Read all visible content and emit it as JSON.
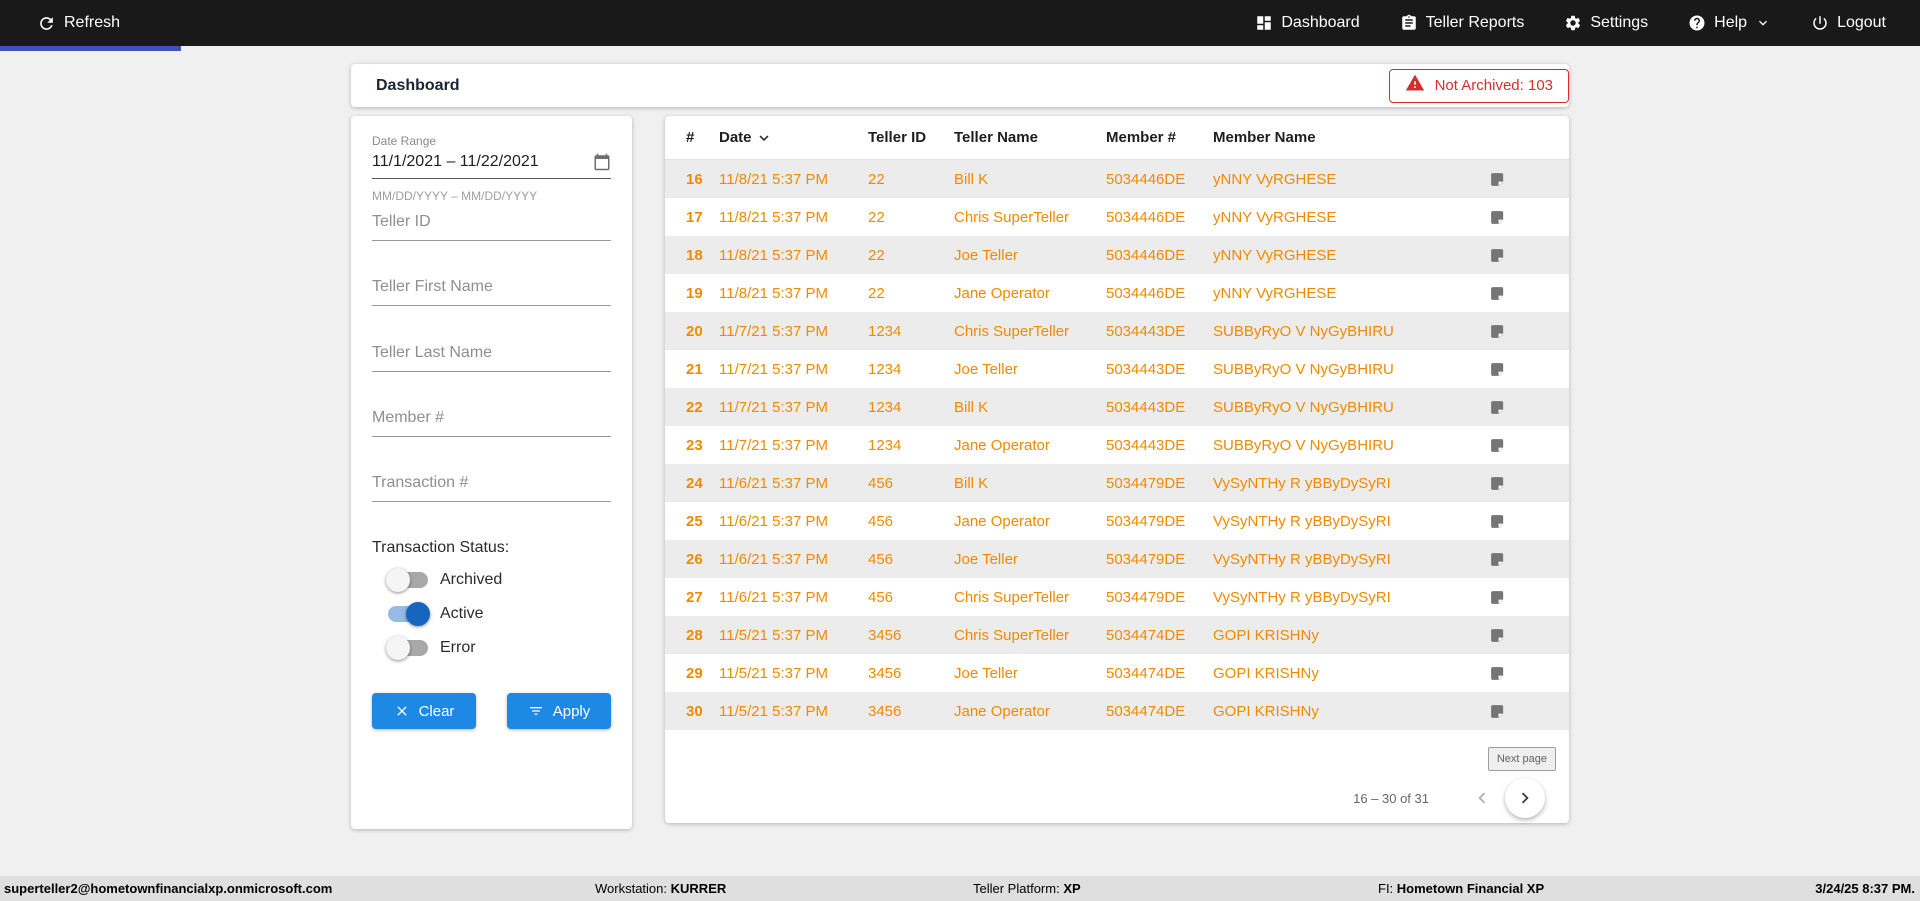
{
  "colors": {
    "navbar_bg": "#191919",
    "accent_indigo": "#4053b4",
    "button_blue": "#1e88e5",
    "toggle_on_blue": "#1565c0",
    "row_text_orange": "#ef8a00",
    "alert_red": "#d32f2f",
    "row_alt_gray": "#ececec",
    "footer_gray": "#dfdfdf"
  },
  "navbar": {
    "refresh_label": "Refresh",
    "items": [
      {
        "label": "Dashboard"
      },
      {
        "label": "Teller Reports"
      },
      {
        "label": "Settings"
      },
      {
        "label": "Help"
      },
      {
        "label": "Logout"
      }
    ]
  },
  "header": {
    "title": "Dashboard",
    "not_archived_label": "Not Archived: 103"
  },
  "filters": {
    "date_range_label": "Date Range",
    "date_range_value": "11/1/2021 – 11/22/2021",
    "date_range_hint": "MM/DD/YYYY – MM/DD/YYYY",
    "teller_id_placeholder": "Teller ID",
    "teller_first_name_placeholder": "Teller First Name",
    "teller_last_name_placeholder": "Teller Last Name",
    "member_placeholder": "Member #",
    "transaction_placeholder": "Transaction #",
    "status_label": "Transaction Status:",
    "toggles": [
      {
        "label": "Archived",
        "on": false
      },
      {
        "label": "Active",
        "on": true
      },
      {
        "label": "Error",
        "on": false
      }
    ],
    "clear_label": "Clear",
    "apply_label": "Apply"
  },
  "table": {
    "columns": [
      "#",
      "Date",
      "Teller ID",
      "Teller Name",
      "Member #",
      "Member Name"
    ],
    "rows": [
      {
        "num": "16",
        "date": "11/8/21 5:37 PM",
        "teller_id": "22",
        "teller_name": "Bill K",
        "member_num": "5034446DE",
        "member_name": "yNNY VyRGHESE"
      },
      {
        "num": "17",
        "date": "11/8/21 5:37 PM",
        "teller_id": "22",
        "teller_name": "Chris SuperTeller",
        "member_num": "5034446DE",
        "member_name": "yNNY VyRGHESE"
      },
      {
        "num": "18",
        "date": "11/8/21 5:37 PM",
        "teller_id": "22",
        "teller_name": "Joe Teller",
        "member_num": "5034446DE",
        "member_name": "yNNY VyRGHESE"
      },
      {
        "num": "19",
        "date": "11/8/21 5:37 PM",
        "teller_id": "22",
        "teller_name": "Jane Operator",
        "member_num": "5034446DE",
        "member_name": "yNNY VyRGHESE"
      },
      {
        "num": "20",
        "date": "11/7/21 5:37 PM",
        "teller_id": "1234",
        "teller_name": "Chris SuperTeller",
        "member_num": "5034443DE",
        "member_name": "SUBByRyO V NyGyBHIRU"
      },
      {
        "num": "21",
        "date": "11/7/21 5:37 PM",
        "teller_id": "1234",
        "teller_name": "Joe Teller",
        "member_num": "5034443DE",
        "member_name": "SUBByRyO V NyGyBHIRU"
      },
      {
        "num": "22",
        "date": "11/7/21 5:37 PM",
        "teller_id": "1234",
        "teller_name": "Bill K",
        "member_num": "5034443DE",
        "member_name": "SUBByRyO V NyGyBHIRU"
      },
      {
        "num": "23",
        "date": "11/7/21 5:37 PM",
        "teller_id": "1234",
        "teller_name": "Jane Operator",
        "member_num": "5034443DE",
        "member_name": "SUBByRyO V NyGyBHIRU"
      },
      {
        "num": "24",
        "date": "11/6/21 5:37 PM",
        "teller_id": "456",
        "teller_name": "Bill K",
        "member_num": "5034479DE",
        "member_name": "VySyNTHy R yBByDySyRI"
      },
      {
        "num": "25",
        "date": "11/6/21 5:37 PM",
        "teller_id": "456",
        "teller_name": "Jane Operator",
        "member_num": "5034479DE",
        "member_name": "VySyNTHy R yBByDySyRI"
      },
      {
        "num": "26",
        "date": "11/6/21 5:37 PM",
        "teller_id": "456",
        "teller_name": "Joe Teller",
        "member_num": "5034479DE",
        "member_name": "VySyNTHy R yBByDySyRI"
      },
      {
        "num": "27",
        "date": "11/6/21 5:37 PM",
        "teller_id": "456",
        "teller_name": "Chris SuperTeller",
        "member_num": "5034479DE",
        "member_name": "VySyNTHy R yBByDySyRI"
      },
      {
        "num": "28",
        "date": "11/5/21 5:37 PM",
        "teller_id": "3456",
        "teller_name": "Chris SuperTeller",
        "member_num": "5034474DE",
        "member_name": "GOPI KRISHNy"
      },
      {
        "num": "29",
        "date": "11/5/21 5:37 PM",
        "teller_id": "3456",
        "teller_name": "Joe Teller",
        "member_num": "5034474DE",
        "member_name": "GOPI KRISHNy"
      },
      {
        "num": "30",
        "date": "11/5/21 5:37 PM",
        "teller_id": "3456",
        "teller_name": "Jane Operator",
        "member_num": "5034474DE",
        "member_name": "GOPI KRISHNy"
      }
    ],
    "pagination": {
      "next_page_label": "Next page",
      "range": "16 – 30 of 31"
    }
  },
  "footer": {
    "user": "superteller2@hometownfinancialxp.onmicrosoft.com",
    "workstation_label": "Workstation:",
    "workstation_value": "KURRER",
    "platform_label": "Teller Platform:",
    "platform_value": "XP",
    "fi_label": "FI:",
    "fi_value": "Hometown Financial XP",
    "datetime": "3/24/25 8:37 PM."
  }
}
